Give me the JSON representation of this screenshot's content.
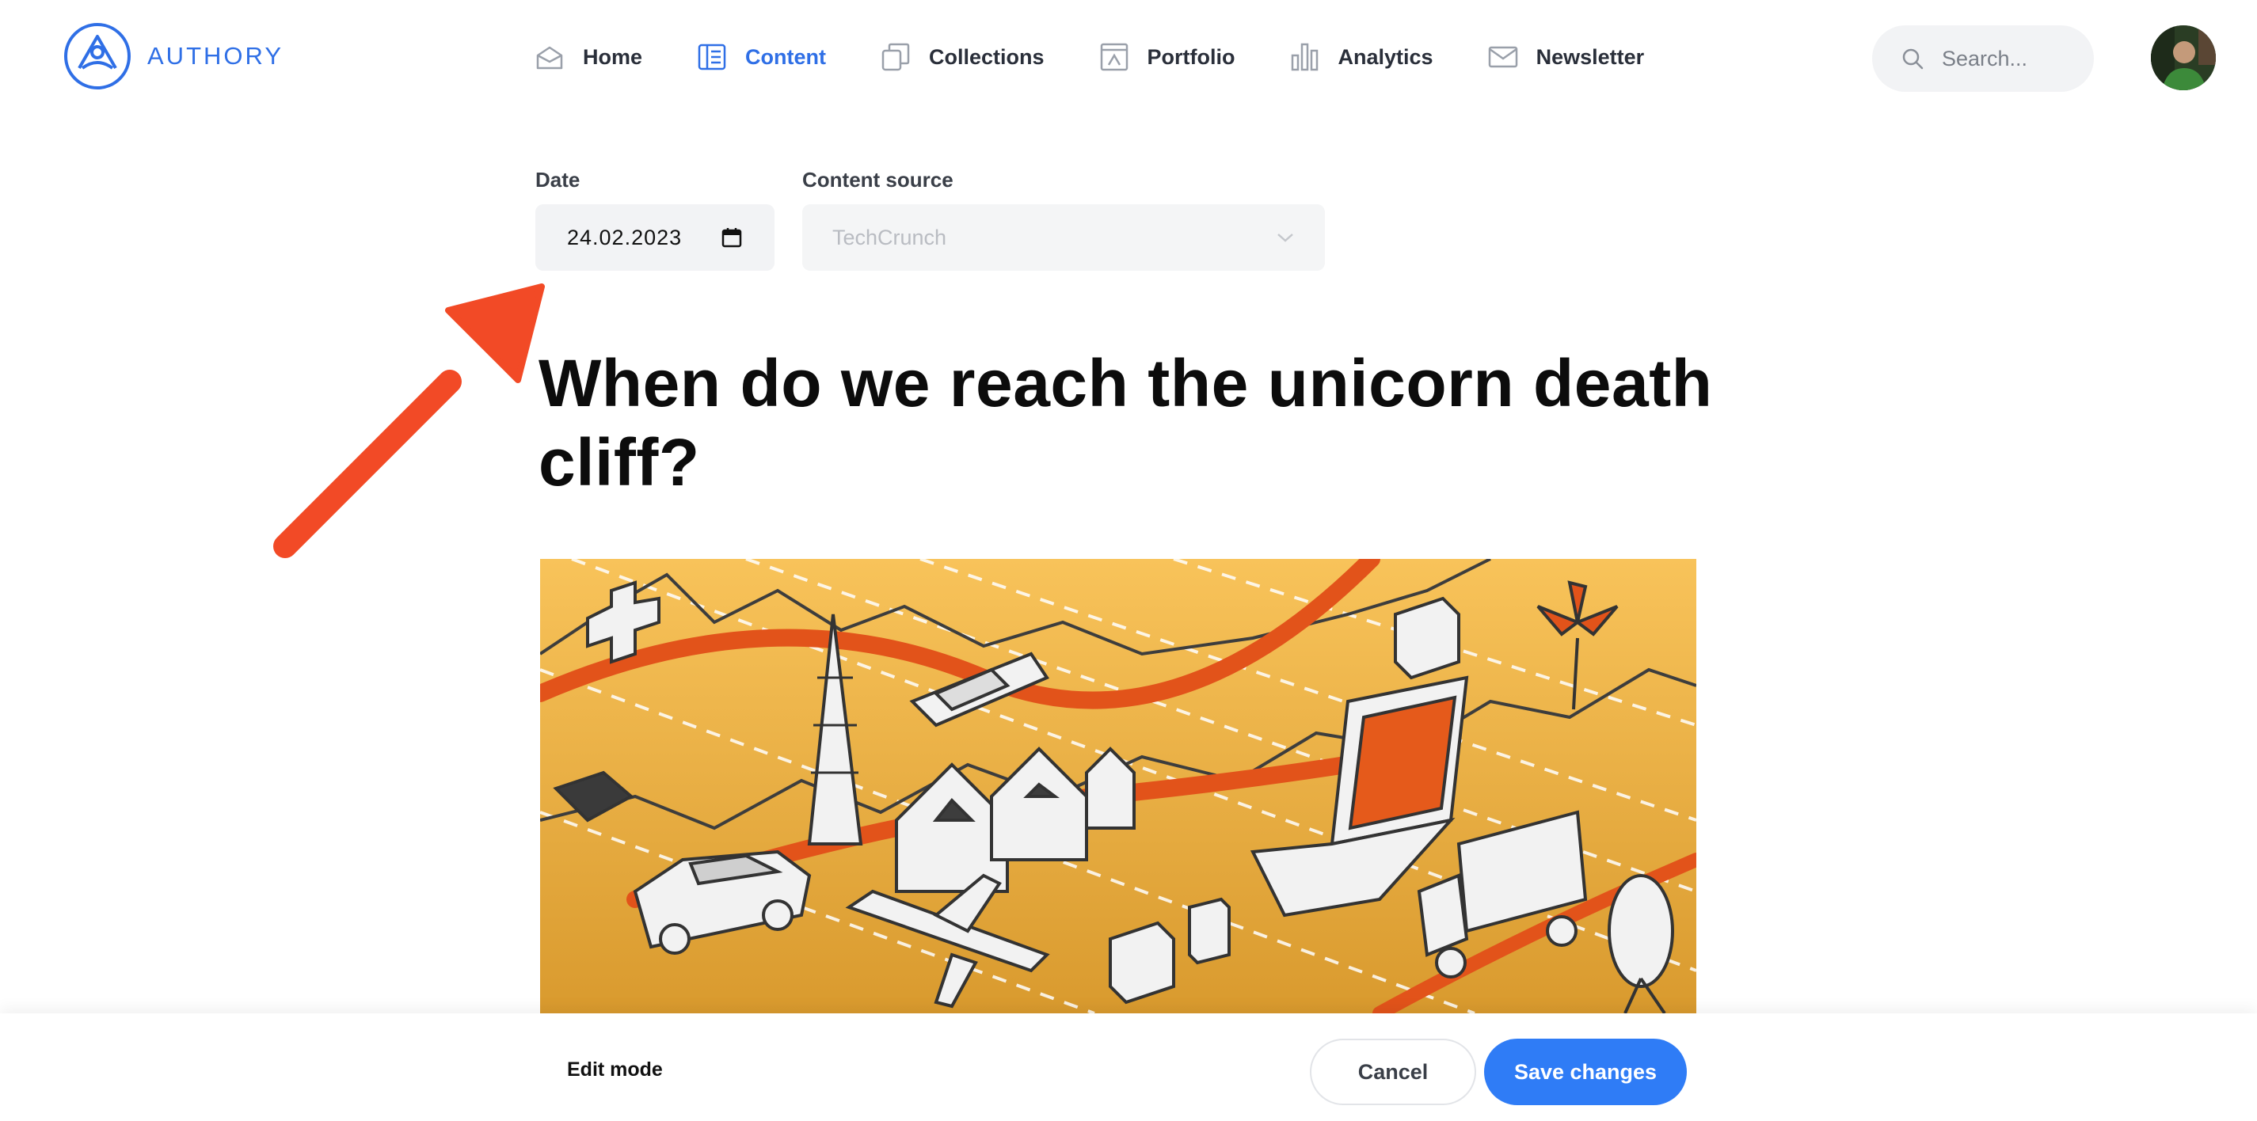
{
  "brand": {
    "name": "AUTHORY",
    "accent_color": "#2f6fe6"
  },
  "nav": {
    "items": [
      {
        "label": "Home",
        "icon": "home-icon",
        "active": false
      },
      {
        "label": "Content",
        "icon": "content-icon",
        "active": true
      },
      {
        "label": "Collections",
        "icon": "collections-icon",
        "active": false
      },
      {
        "label": "Portfolio",
        "icon": "portfolio-icon",
        "active": false
      },
      {
        "label": "Analytics",
        "icon": "analytics-icon",
        "active": false
      },
      {
        "label": "Newsletter",
        "icon": "newsletter-icon",
        "active": false
      }
    ]
  },
  "search": {
    "placeholder": "Search..."
  },
  "form": {
    "date": {
      "label": "Date",
      "value": "24.02.2023"
    },
    "content_source": {
      "label": "Content source",
      "value": "TechCrunch"
    }
  },
  "article": {
    "title": "When do we reach the unicorn death cliff?"
  },
  "annotation": {
    "color": "#f24a26",
    "icon": "arrow-annotation"
  },
  "bottom_bar": {
    "mode_label": "Edit mode",
    "cancel_label": "Cancel",
    "save_label": "Save changes",
    "save_color": "#2f7cf6"
  }
}
